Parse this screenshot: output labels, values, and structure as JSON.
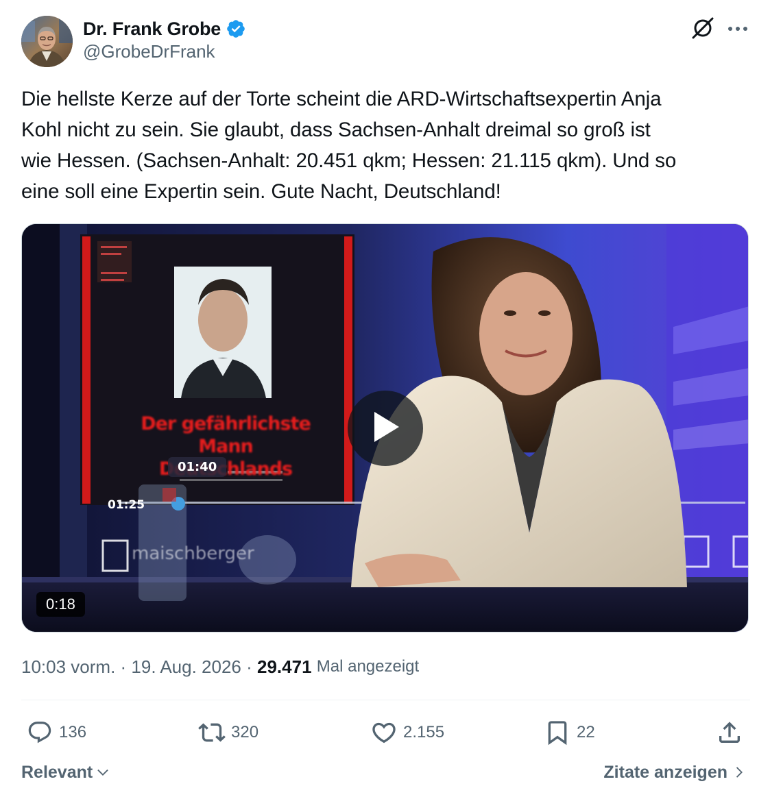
{
  "author": {
    "display_name": "Dr. Frank Grobe",
    "handle": "@GrobeDrFrank",
    "verified": true
  },
  "header": {
    "grok_icon": "grok-icon",
    "more_icon": "more-horizontal-icon"
  },
  "tweet": {
    "text": "Die hellste Kerze auf der Torte scheint die ARD-Wirtschaftsexpertin Anja\nKohl nicht zu sein. Sie glaubt, dass Sachsen-Anhalt dreimal so groß ist\nwie Hessen. (Sachsen-Anhalt: 20.451 qkm; Hessen: 21.115 qkm). Und so\neine soll eine Expertin sein. Gute Nacht, Deutschland!"
  },
  "media": {
    "type": "video",
    "duration": "0:18",
    "inner_hover_time": "01:40",
    "inner_current_time": "01:25",
    "book_title": "Der gefährlichste Mann Deutschlands",
    "show_brand": "maischberger"
  },
  "meta": {
    "time": "10:03 vorm.",
    "separator": " · ",
    "date": "19. Aug. 2026",
    "views_count": "29.471",
    "views_label": "Mal angezeigt"
  },
  "actions": {
    "replies": "136",
    "retweets": "320",
    "likes": "2.155",
    "bookmarks": "22"
  },
  "footer": {
    "sort_label": "Relevant",
    "quotes_label": "Zitate anzeigen"
  },
  "colors": {
    "text_primary": "#0f1419",
    "text_secondary": "#536471",
    "verified_blue": "#1d9bf0",
    "divider": "#eff3f4"
  }
}
